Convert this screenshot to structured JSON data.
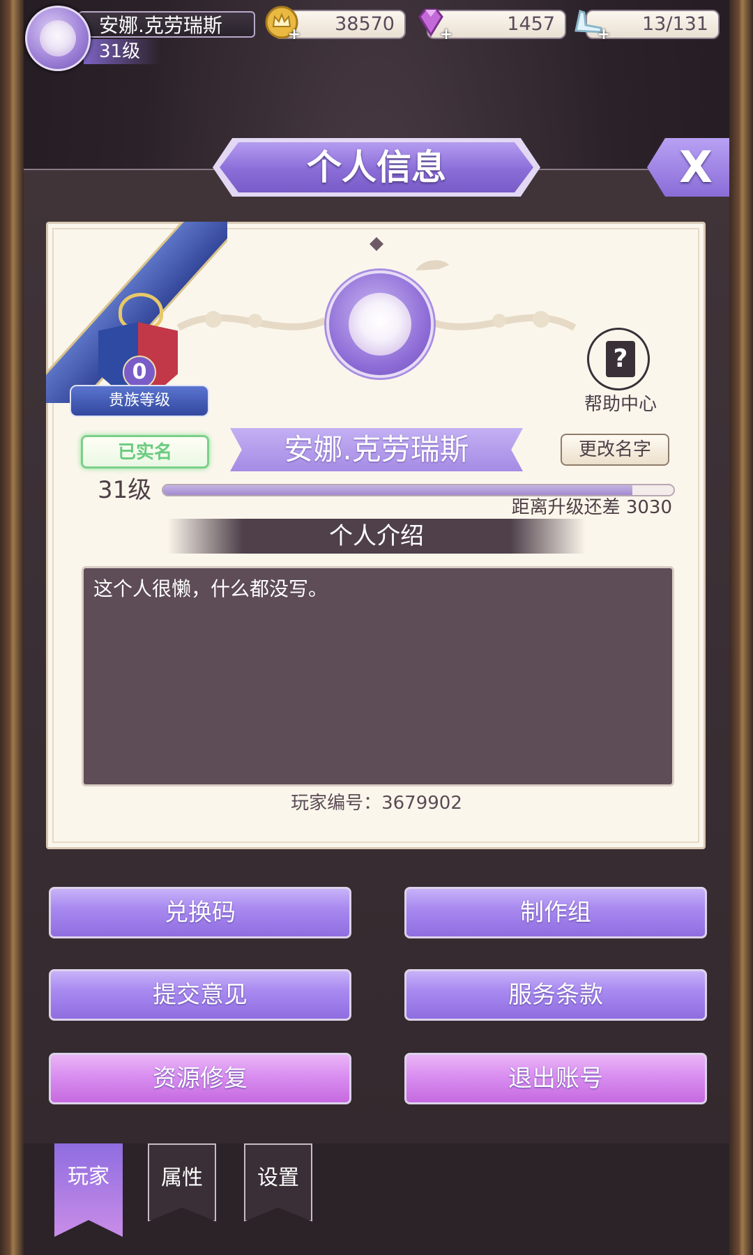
{
  "topbar": {
    "player_name": "安娜.克劳瑞斯",
    "player_level": "31级",
    "gold": "38570",
    "gems": "1457",
    "stamina": "13/131"
  },
  "panel": {
    "title": "个人信息",
    "close_label": "X"
  },
  "profile": {
    "noble_level_value": "0",
    "noble_level_label": "贵族等级",
    "help_label": "帮助中心",
    "verified_label": "已实名",
    "name": "安娜.克劳瑞斯",
    "rename_label": "更改名字",
    "level_label": "31级",
    "xp_progress": 0.92,
    "xp_remaining_text": "距离升级还差 3030",
    "intro_header": "个人介绍",
    "intro_text": "这个人很懒，什么都没写。",
    "player_id": "玩家编号：3679902"
  },
  "buttons": {
    "redeem": "兑换码",
    "credits": "制作组",
    "feedback": "提交意见",
    "terms": "服务条款",
    "repair": "资源修复",
    "logout": "退出账号"
  },
  "tabs": [
    {
      "label": "玩家",
      "active": true
    },
    {
      "label": "属性",
      "active": false
    },
    {
      "label": "设置",
      "active": false
    }
  ],
  "colors": {
    "accent_purple": "#9b7ee6",
    "accent_pink": "#d98ef0",
    "card_bg": "#fbf6ec"
  }
}
